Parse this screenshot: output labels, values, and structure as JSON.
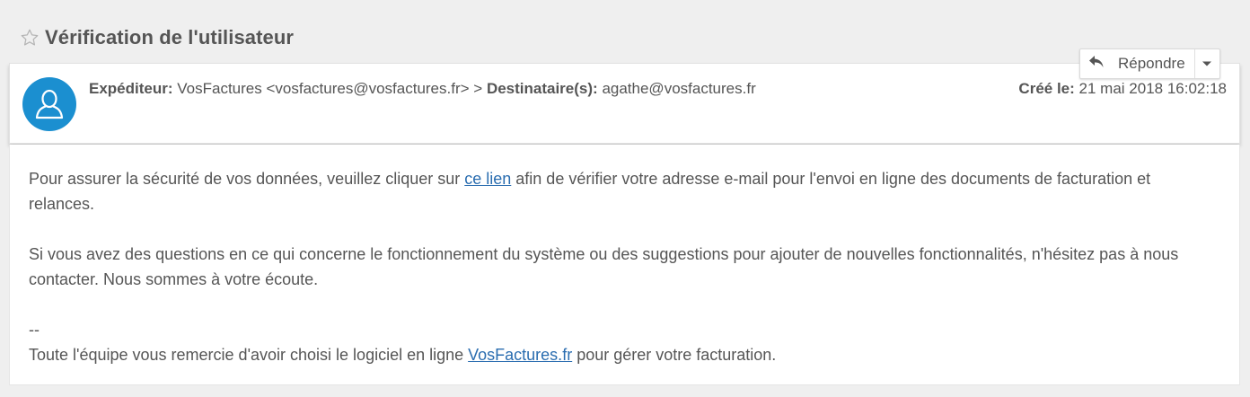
{
  "email": {
    "subject": "Vérification de l'utilisateur",
    "sender_label": "Expéditeur:",
    "sender_value": "VosFactures <vosfactures@vosfactures.fr> >",
    "recipient_label": "Destinataire(s):",
    "recipient_value": "agathe@vosfactures.fr",
    "created_label": "Créé le:",
    "created_value": "21 mai 2018 16:02:18"
  },
  "actions": {
    "reply_label": "Répondre"
  },
  "body": {
    "p1_before": "Pour assurer la sécurité de vos données, veuillez cliquer sur ",
    "p1_link": "ce lien",
    "p1_after": " afin de vérifier votre adresse e-mail pour l'envoi en ligne des documents de facturation et relances.",
    "p2": "Si vous avez des questions en ce qui concerne le fonctionnement du système ou des suggestions pour ajouter de nouvelles fonctionnalités, n'hésitez pas à nous contacter. Nous sommes à votre écoute.",
    "sig_sep": "--",
    "sig_before": "Toute l'équipe vous remercie d'avoir choisi le logiciel en ligne ",
    "sig_link": "VosFactures.fr",
    "sig_after": " pour gérer votre facturation."
  },
  "icons": {
    "star": "star-outline-icon",
    "avatar": "user-silhouette-icon",
    "reply": "reply-arrow-icon",
    "caret": "caret-down-icon"
  },
  "colors": {
    "avatar_bg": "#1b8fd0",
    "link": "#2a6db0",
    "text": "#555555",
    "page_bg": "#efefef"
  }
}
